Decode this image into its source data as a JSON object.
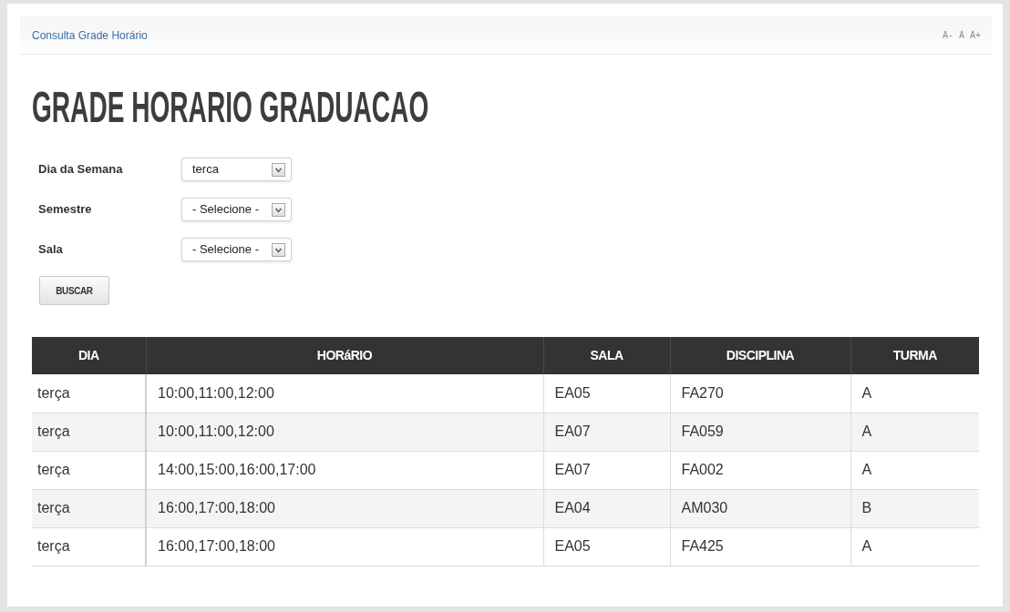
{
  "breadcrumb": {
    "label": "Consulta Grade Horário"
  },
  "font_size_controls": [
    "A-",
    "A",
    "A+"
  ],
  "title": "GRADE HORARIO GRADUACAO",
  "form": {
    "fields": [
      {
        "label": "Dia da Semana",
        "value": "terca"
      },
      {
        "label": "Semestre",
        "value": "- Selecione -"
      },
      {
        "label": "Sala",
        "value": "- Selecione -"
      }
    ],
    "submit": "BUSCAR"
  },
  "table": {
    "columns": [
      "DIA",
      "HORáRIO",
      "SALA",
      "DISCIPLINA",
      "TURMA"
    ],
    "rows": [
      [
        "terça",
        "10:00,11:00,12:00",
        "EA05",
        "FA270",
        "A"
      ],
      [
        "terça",
        "10:00,11:00,12:00",
        "EA07",
        "FA059",
        "A"
      ],
      [
        "terça",
        "14:00,15:00,16:00,17:00",
        "EA07",
        "FA002",
        "A"
      ],
      [
        "terça",
        "16:00,17:00,18:00",
        "EA04",
        "AM030",
        "B"
      ],
      [
        "terça",
        "16:00,17:00,18:00",
        "EA05",
        "FA425",
        "A"
      ]
    ]
  }
}
